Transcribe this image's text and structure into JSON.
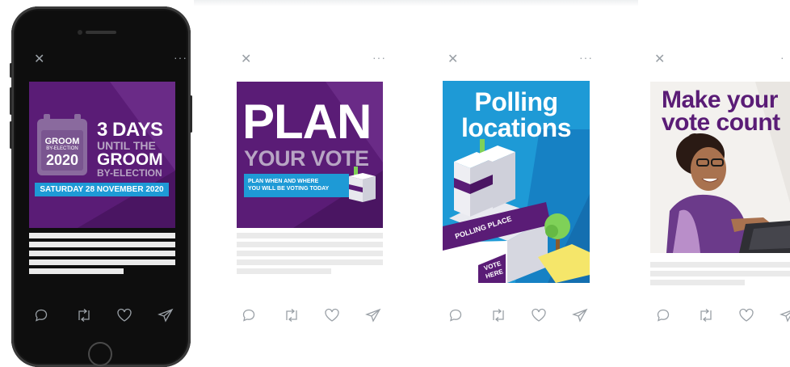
{
  "posts": [
    {
      "graphic": {
        "badge_top": "GROOM",
        "badge_mid": "BY-ELECTION",
        "badge_year": "2020",
        "big": "3 DAYS",
        "line2": "UNTIL THE",
        "line3": "GROOM",
        "line4": "BY-ELECTION",
        "banner": "SATURDAY 28 NOVEMBER 2020"
      }
    },
    {
      "graphic": {
        "title": "PLAN",
        "subtitle": "YOUR VOTE",
        "banner_line1": "PLAN WHEN AND WHERE",
        "banner_line2": "YOU WILL BE VOTING TODAY"
      }
    },
    {
      "graphic": {
        "title_line1": "Polling",
        "title_line2": "locations",
        "sign": "POLLING PLACE",
        "vote_line1": "VOTE",
        "vote_line2": "HERE"
      }
    },
    {
      "graphic": {
        "title_line1": "Make your",
        "title_line2": "vote count"
      }
    }
  ],
  "icons": {
    "close": "close-icon",
    "more": "more-icon",
    "reply": "reply-icon",
    "retweet": "retweet-icon",
    "like": "like-icon",
    "share": "share-icon"
  },
  "colors": {
    "aec_purple": "#5a1c76",
    "aec_blue": "#1e9ad6",
    "placeholder_gray": "#eaeaea",
    "icon_gray": "#9aa0a6"
  }
}
